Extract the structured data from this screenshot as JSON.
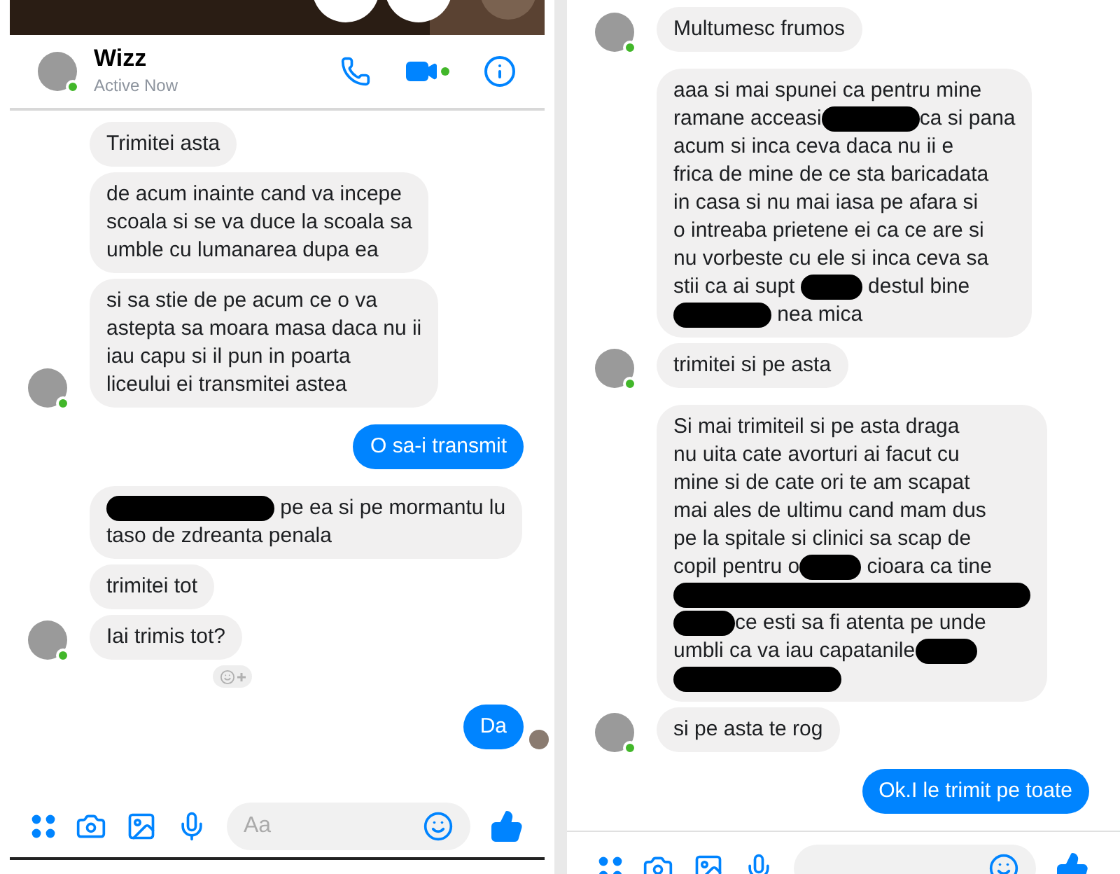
{
  "left": {
    "header": {
      "name": "Wizz",
      "status": "Active Now"
    },
    "messages": [
      {
        "kind": "incoming",
        "lines": [
          [
            {
              "kind": "text",
              "text": "Trimitei asta"
            }
          ]
        ]
      },
      {
        "kind": "incoming",
        "lines": [
          [
            {
              "kind": "text",
              "text": "de acum inainte cand va incepe"
            }
          ],
          [
            {
              "kind": "text",
              "text": "scoala si se va duce la scoala sa"
            }
          ],
          [
            {
              "kind": "text",
              "text": "umble cu lumanarea dupa ea"
            }
          ]
        ]
      },
      {
        "kind": "incoming",
        "avatar": true,
        "lines": [
          [
            {
              "kind": "text",
              "text": "si sa stie de pe acum ce o va"
            }
          ],
          [
            {
              "kind": "text",
              "text": "astepta sa moara masa daca nu ii"
            }
          ],
          [
            {
              "kind": "text",
              "text": "iau capu si il pun in poarta"
            }
          ],
          [
            {
              "kind": "text",
              "text": "liceului ei transmitei astea"
            }
          ]
        ]
      },
      {
        "kind": "outgoing",
        "lines": [
          [
            {
              "kind": "text",
              "text": "O sa-i transmit"
            }
          ]
        ]
      },
      {
        "kind": "incoming",
        "lines": [
          [
            {
              "kind": "bar"
            },
            {
              "kind": "text",
              "text": " pe ea si pe mormantu lu"
            }
          ],
          [
            {
              "kind": "text",
              "text": "taso de zdreanta penala"
            }
          ]
        ]
      },
      {
        "kind": "incoming",
        "lines": [
          [
            {
              "kind": "text",
              "text": "trimitei tot"
            }
          ]
        ]
      },
      {
        "kind": "incoming",
        "avatar": true,
        "reaction_button": true,
        "lines": [
          [
            {
              "kind": "text",
              "text": "Iai trimis tot?"
            }
          ]
        ]
      },
      {
        "kind": "outgoing",
        "seen": true,
        "lines": [
          [
            {
              "kind": "text",
              "text": "Da"
            }
          ]
        ]
      }
    ],
    "composer": {
      "placeholder": "Aa"
    }
  },
  "right": {
    "messages": [
      {
        "kind": "incoming",
        "avatar": true,
        "lines": [
          [
            {
              "kind": "text",
              "text": "Multumesc frumos"
            }
          ]
        ]
      },
      {
        "kind": "incoming",
        "lines": [
          [
            {
              "kind": "text",
              "text": "aaa si mai spunei ca pentru mine"
            }
          ],
          [
            {
              "kind": "text",
              "text": "ramane acceasi"
            },
            {
              "kind": "blot"
            },
            {
              "kind": "text",
              "text": "ca si pana"
            }
          ],
          [
            {
              "kind": "text",
              "text": "acum si inca ceva daca nu ii e"
            }
          ],
          [
            {
              "kind": "text",
              "text": "frica de mine de ce sta baricadata"
            }
          ],
          [
            {
              "kind": "text",
              "text": "in casa si nu mai iasa pe afara si"
            }
          ],
          [
            {
              "kind": "text",
              "text": "o intreaba prietene ei ca ce are si"
            }
          ],
          [
            {
              "kind": "text",
              "text": "nu vorbeste cu ele si inca ceva sa"
            }
          ],
          [
            {
              "kind": "text",
              "text": "stii ca ai supt "
            },
            {
              "kind": "dot"
            },
            {
              "kind": "text",
              "text": " destul bine"
            }
          ],
          [
            {
              "kind": "blot"
            },
            {
              "kind": "text",
              "text": " nea mica"
            }
          ]
        ]
      },
      {
        "kind": "incoming",
        "avatar": true,
        "lines": [
          [
            {
              "kind": "text",
              "text": "trimitei si pe asta"
            }
          ]
        ]
      },
      {
        "kind": "incoming",
        "lines": [
          [
            {
              "kind": "text",
              "text": "Si mai trimiteil si pe asta draga"
            }
          ],
          [
            {
              "kind": "text",
              "text": "nu uita cate avorturi ai facut cu"
            }
          ],
          [
            {
              "kind": "text",
              "text": "mine si de cate ori te am scapat"
            }
          ],
          [
            {
              "kind": "text",
              "text": "mai ales de ultimu cand mam dus"
            }
          ],
          [
            {
              "kind": "text",
              "text": "pe la spitale si clinici sa scap de"
            }
          ],
          [
            {
              "kind": "text",
              "text": "copil pentru o"
            },
            {
              "kind": "dot"
            },
            {
              "kind": "text",
              "text": " cioara ca tine"
            }
          ],
          [
            {
              "kind": "line"
            }
          ],
          [
            {
              "kind": "dot"
            },
            {
              "kind": "text",
              "text": "ce esti sa fi atenta pe unde"
            }
          ],
          [
            {
              "kind": "text",
              "text": "umbli ca va iau capatanile"
            },
            {
              "kind": "dot"
            }
          ],
          [
            {
              "kind": "bar"
            }
          ]
        ]
      },
      {
        "kind": "incoming",
        "avatar": true,
        "lines": [
          [
            {
              "kind": "text",
              "text": "si pe asta te rog"
            }
          ]
        ]
      },
      {
        "kind": "outgoing",
        "lines": [
          [
            {
              "kind": "text",
              "text": "Ok.I le trimit pe toate"
            }
          ]
        ]
      }
    ]
  }
}
